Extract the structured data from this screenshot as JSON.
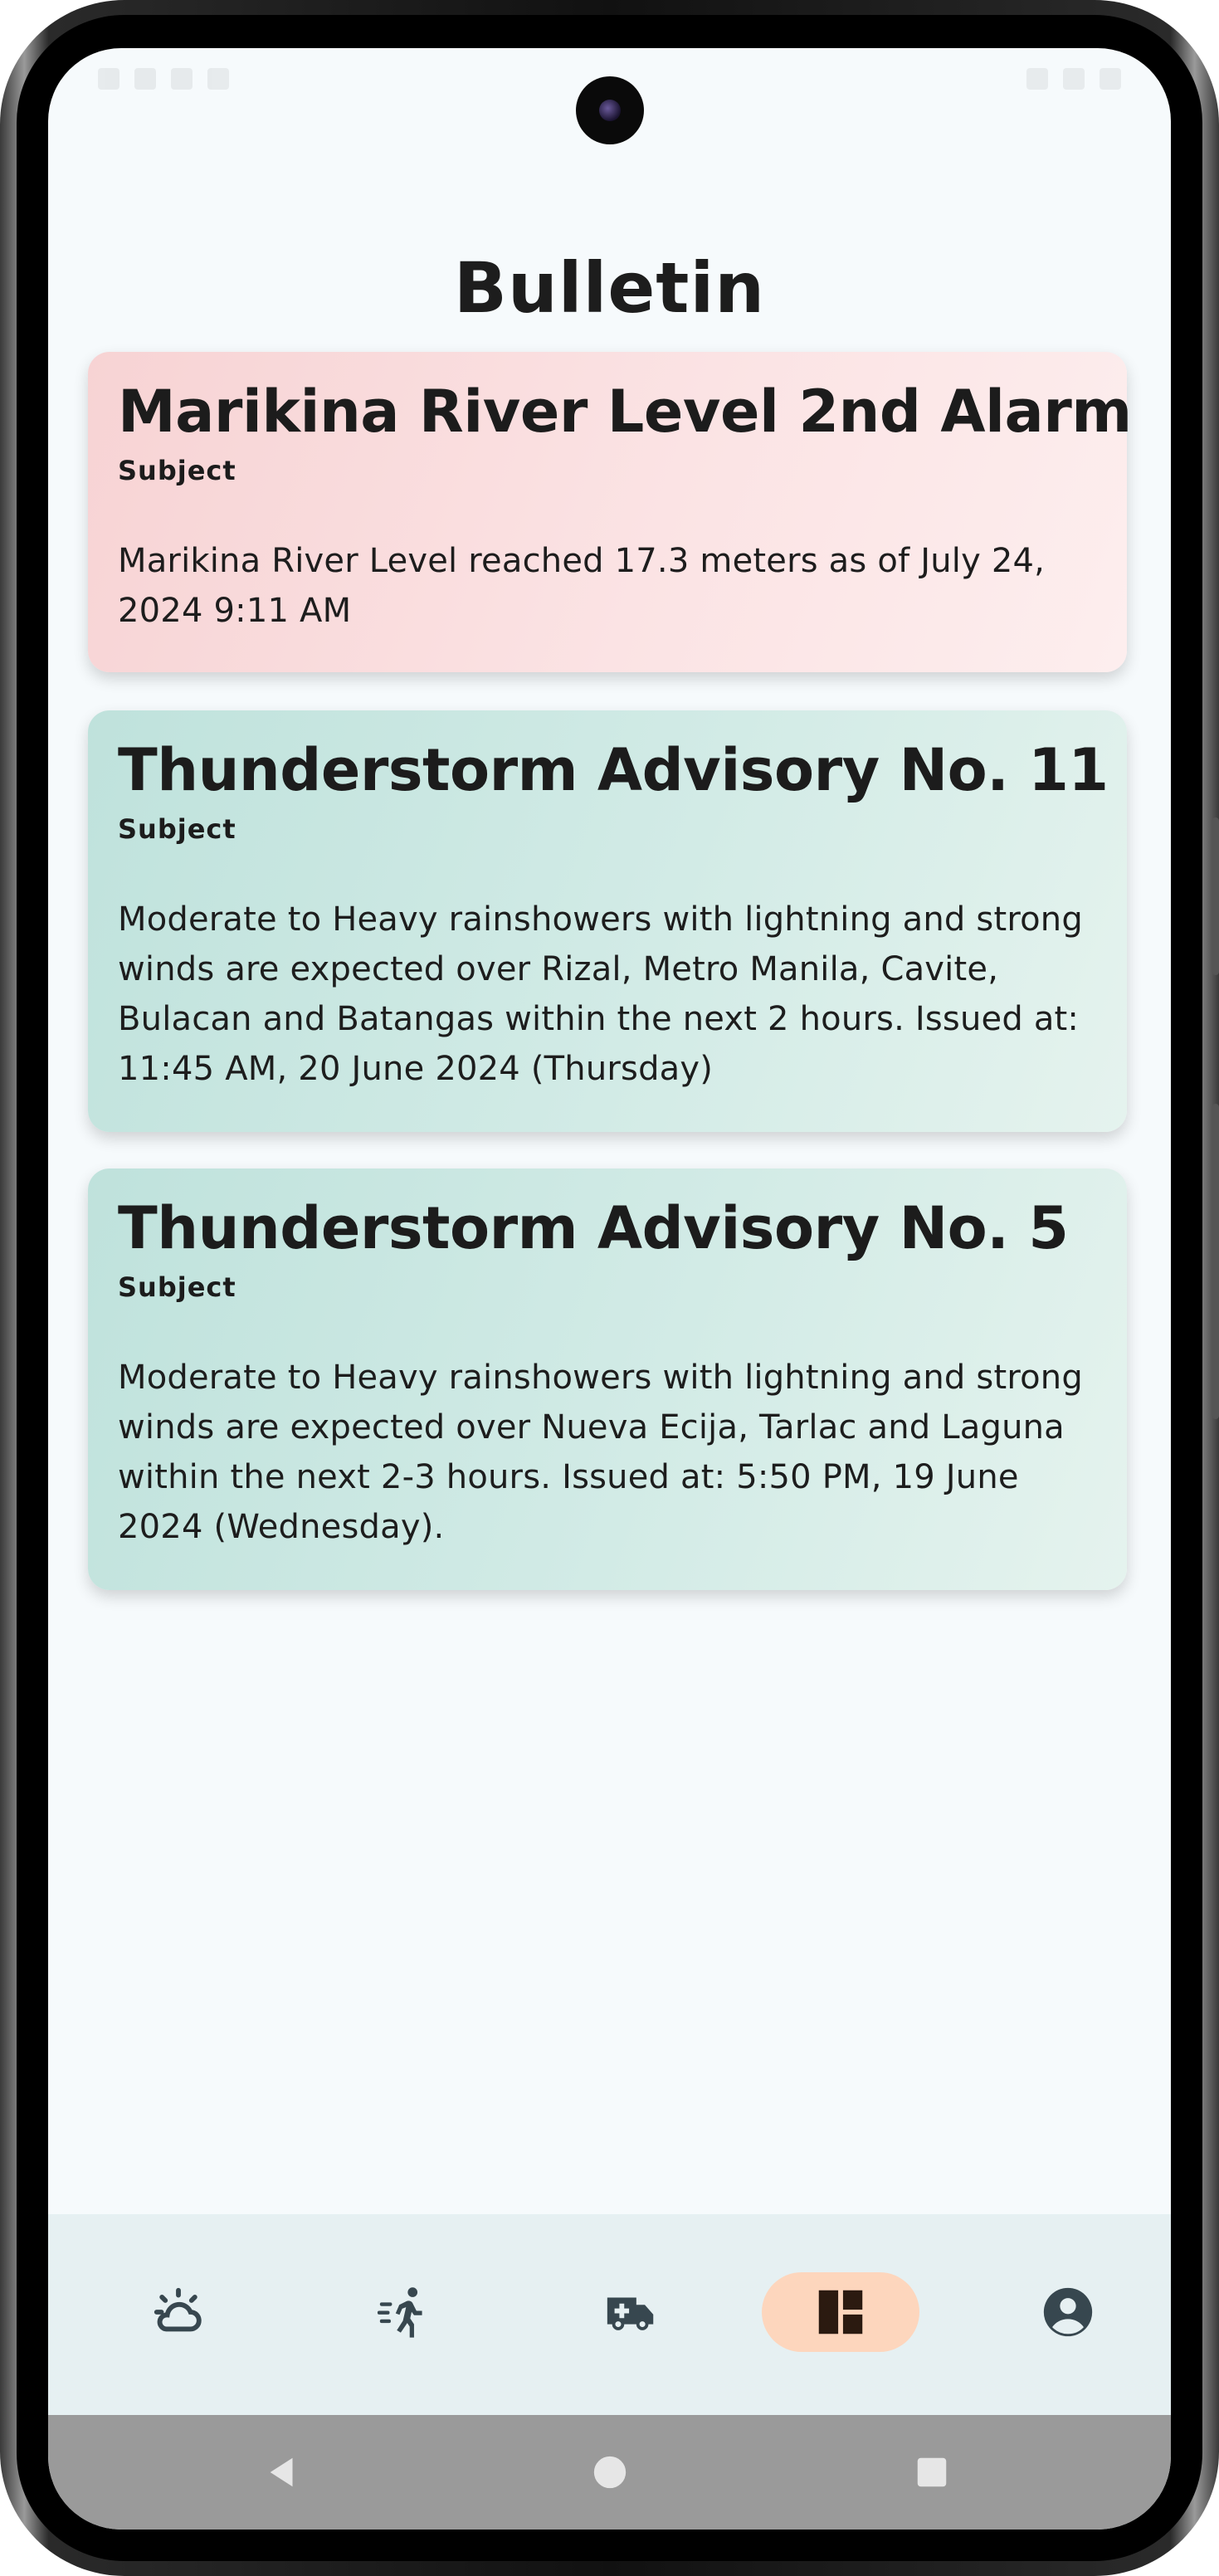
{
  "page": {
    "title": "Bulletin"
  },
  "bulletins": [
    {
      "title": "Marikina River Level 2nd Alarm",
      "subject_label": "Subject",
      "body": "Marikina River Level reached 17.3 meters as of July 24, 2024 9:11 AM",
      "color": "#f9dcdd"
    },
    {
      "title": "Thunderstorm Advisory No. 11",
      "subject_label": "Subject",
      "body": "Moderate to Heavy rainshowers with lightning and strong winds are expected over Rizal, Metro Manila, Cavite, Bulacan and Batangas within the next 2 hours. Issued at: 11:45 AM, 20 June 2024 (Thursday)",
      "color": "#cfe9e3"
    },
    {
      "title": "Thunderstorm Advisory No. 5",
      "subject_label": "Subject",
      "body": "Moderate to Heavy rainshowers with lightning and strong winds are expected over Nueva Ecija, Tarlac and Laguna within the next 2-3 hours. Issued at: 5:50 PM, 19 June 2024 (Wednesday).",
      "color": "#cfe9e3"
    }
  ],
  "bottom_nav": {
    "items": [
      {
        "icon": "weather-icon",
        "active": false
      },
      {
        "icon": "evacuation-icon",
        "active": false
      },
      {
        "icon": "ambulance-icon",
        "active": false
      },
      {
        "icon": "dashboard-icon",
        "active": true
      },
      {
        "icon": "account-icon",
        "active": false
      }
    ],
    "active_color": "#fdd6bd"
  },
  "system_nav": {
    "items": [
      "back-icon",
      "home-icon",
      "recents-icon"
    ]
  }
}
